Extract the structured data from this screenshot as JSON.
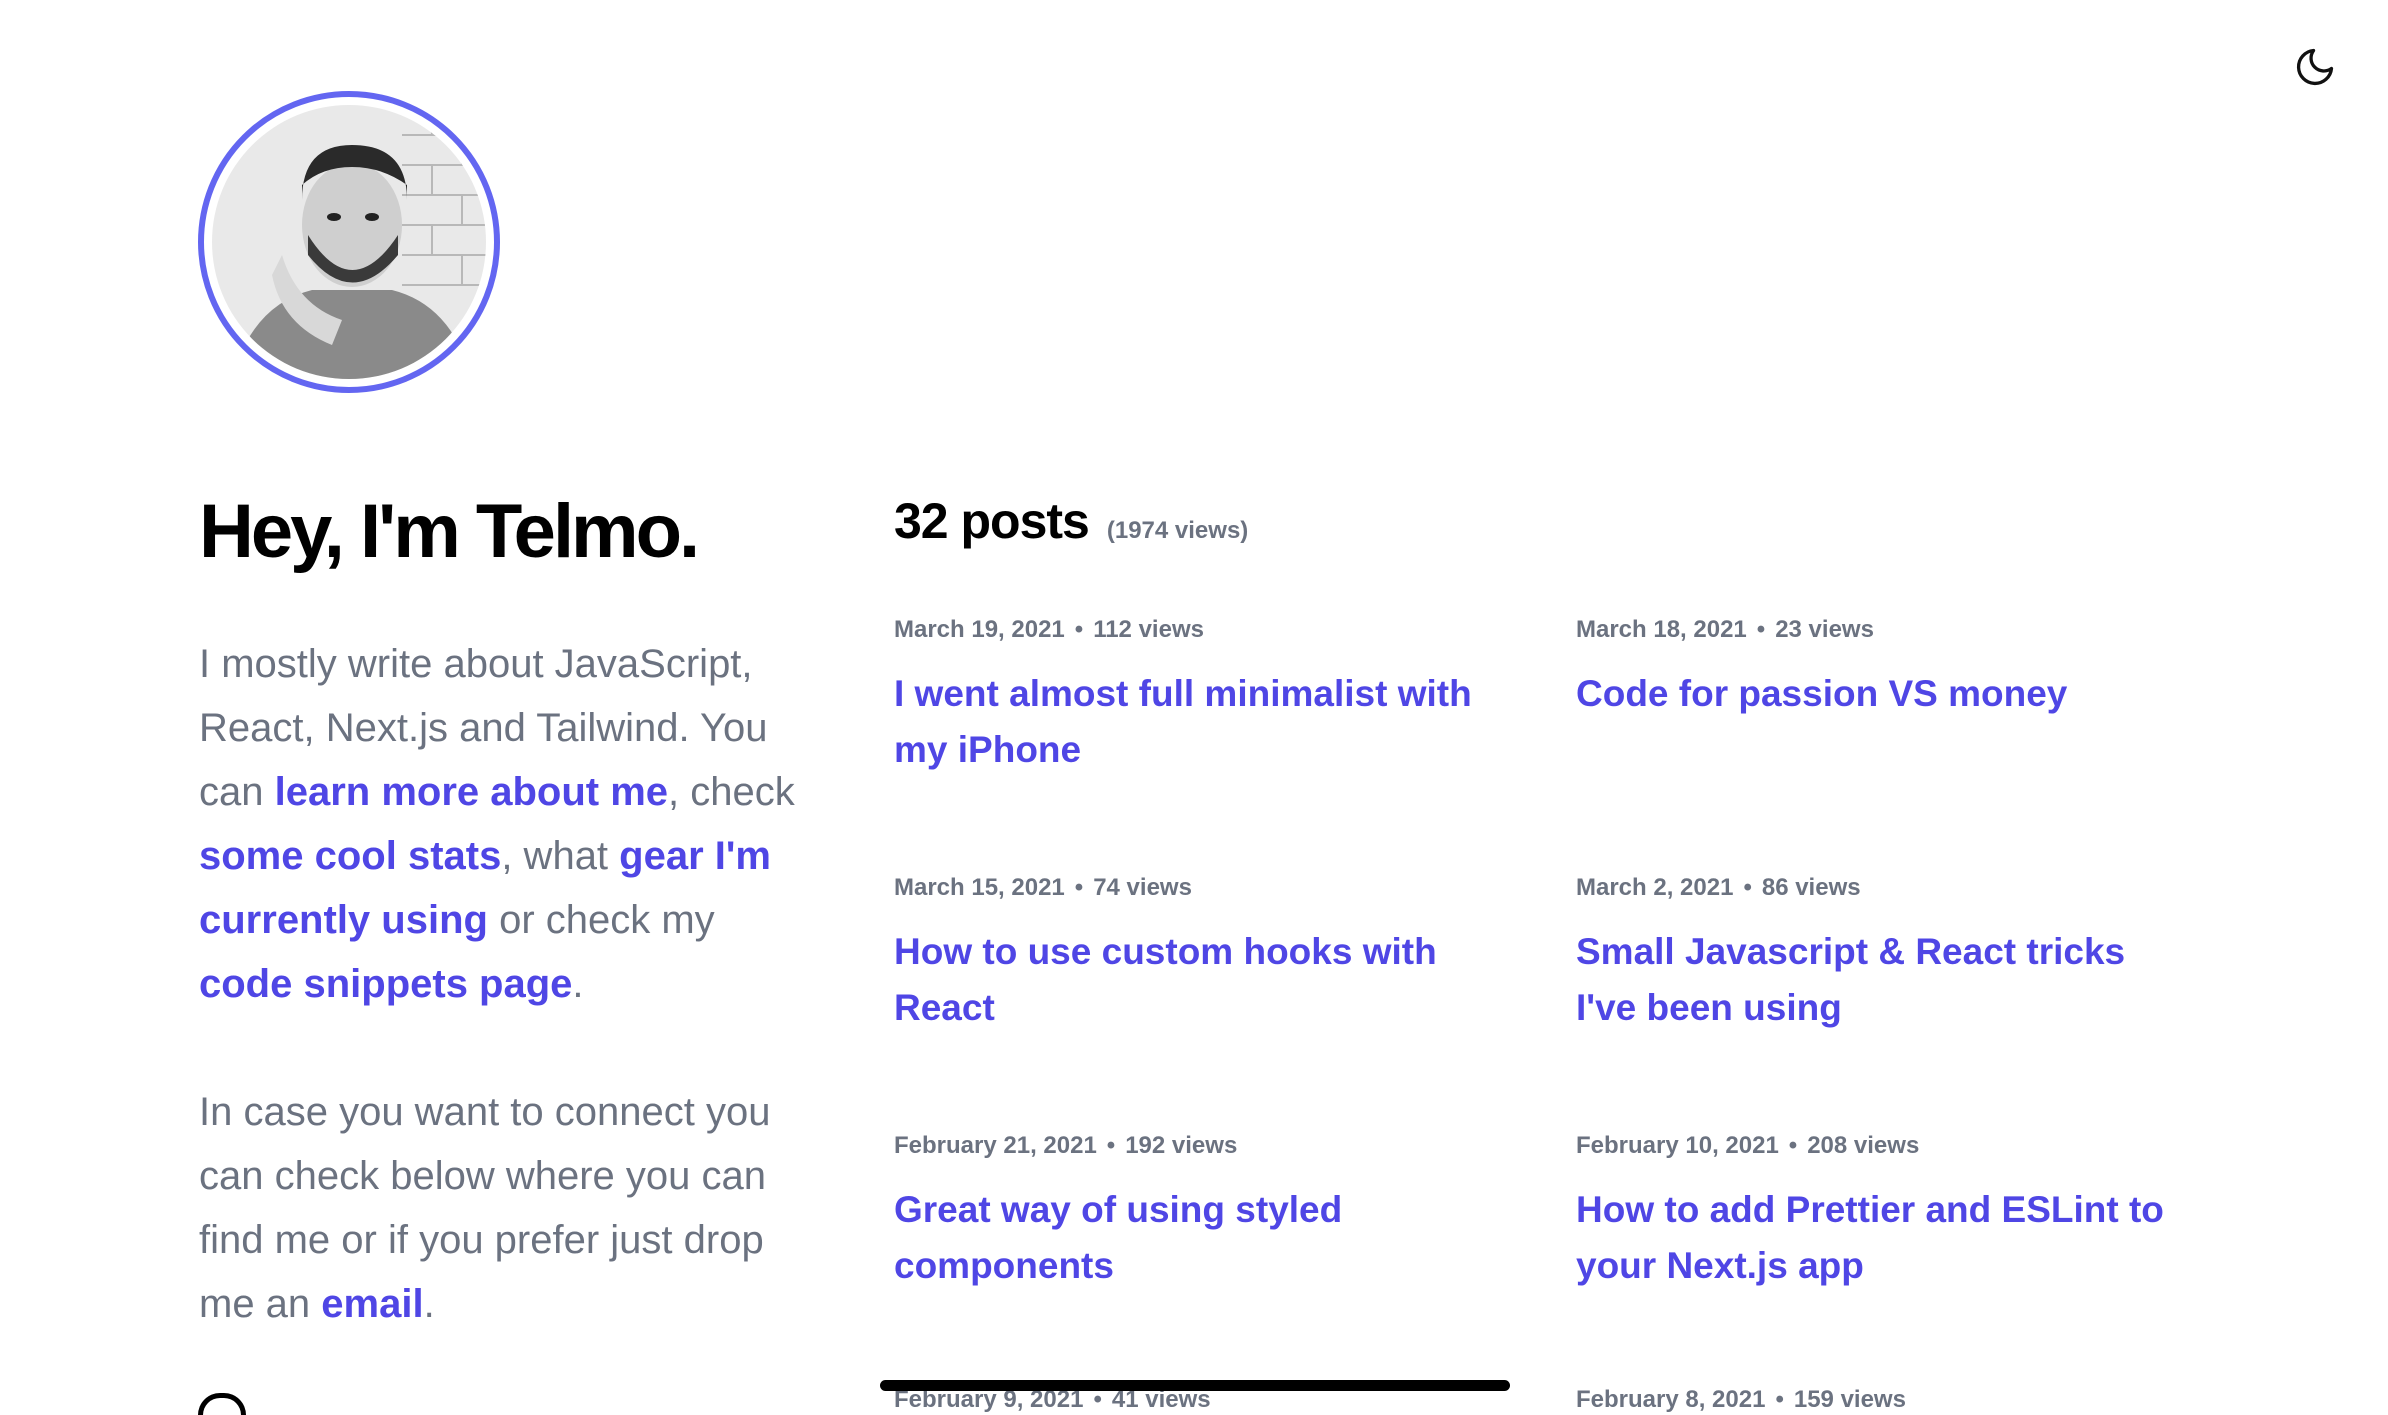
{
  "theme_toggle": {
    "icon": "moon-icon"
  },
  "hero": {
    "title": "Hey, I'm Telmo."
  },
  "intro1": {
    "t1": "I mostly write about JavaScript, React, Next.js and Tailwind. You can ",
    "l1": "learn more about me",
    "t2": ", check ",
    "l2": "some cool stats",
    "t3": ", what ",
    "l3": "gear I'm currently using",
    "t4": " or check my ",
    "l4": "code snippets page",
    "t5": "."
  },
  "intro2": {
    "t1": "In case you want to connect you can check below where you can find me or if you prefer just drop me an ",
    "l1": "email",
    "t2": "."
  },
  "posts_header": {
    "count": "32 posts",
    "views": "(1974 views)"
  },
  "posts": [
    {
      "date": "March 19, 2021",
      "views": "112 views",
      "title": "I went almost full minimalist with my iPhone"
    },
    {
      "date": "March 18, 2021",
      "views": "23 views",
      "title": "Code for passion VS money"
    },
    {
      "date": "March 15, 2021",
      "views": "74 views",
      "title": "How to use custom hooks with React"
    },
    {
      "date": "March 2, 2021",
      "views": "86 views",
      "title": "Small Javascript & React tricks I've been using"
    },
    {
      "date": "February 21, 2021",
      "views": "192 views",
      "title": "Great way of using styled components"
    },
    {
      "date": "February 10, 2021",
      "views": "208 views",
      "title": "How to add Prettier and ESLint to your Next.js app"
    },
    {
      "date": "February 9, 2021",
      "views": "41 views",
      "title": ""
    },
    {
      "date": "February 8, 2021",
      "views": "159 views",
      "title": ""
    }
  ],
  "colors": {
    "accent": "#4f46e5",
    "avatar_ring": "#6366f1",
    "muted": "#6b7280"
  }
}
